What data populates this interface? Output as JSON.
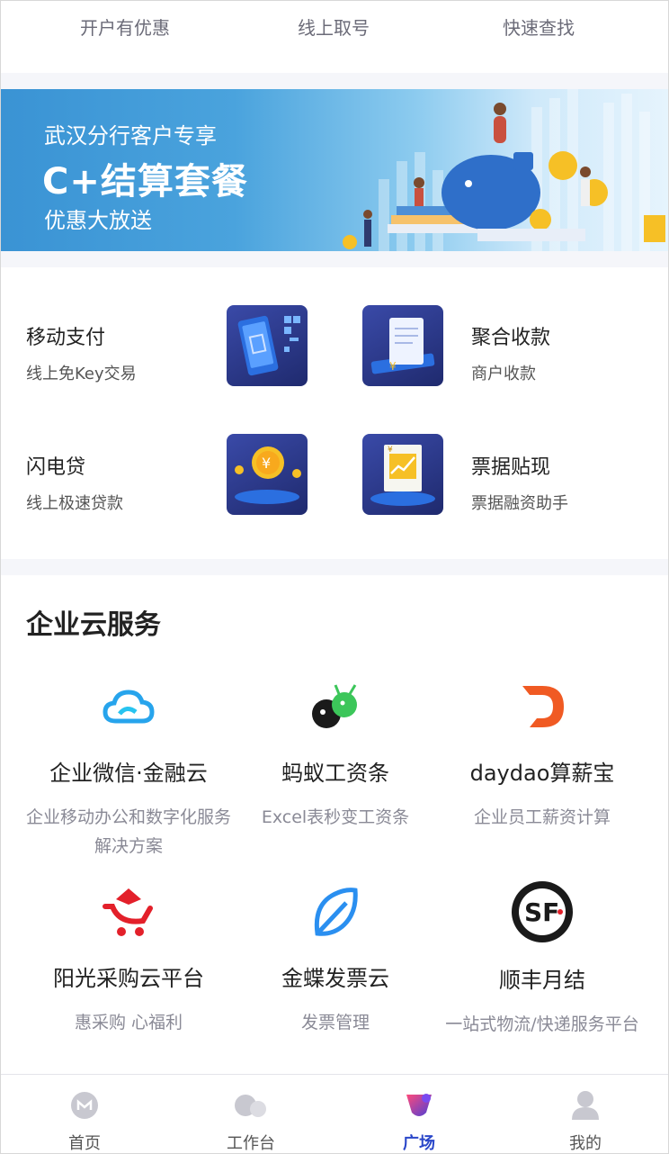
{
  "top_links": [
    "开户有优惠",
    "线上取号",
    "快速查找"
  ],
  "banner": {
    "line1": "武汉分行客户专享",
    "headline": "C+结算套餐",
    "line2": "优惠大放送"
  },
  "products": [
    {
      "title": "移动支付",
      "subtitle": "线上免Key交易",
      "icon": "phone-qr-icon"
    },
    {
      "title": "聚合收款",
      "subtitle": "商户收款",
      "icon": "receipt-icon"
    },
    {
      "title": "闪电贷",
      "subtitle": "线上极速贷款",
      "icon": "yuan-coin-icon"
    },
    {
      "title": "票据贴现",
      "subtitle": "票据融资助手",
      "icon": "bill-chart-icon"
    }
  ],
  "cloud_section": {
    "title": "企业云服务",
    "services": [
      {
        "name": "企业微信·金融云",
        "desc": "企业移动办公和数字化服务解决方案",
        "icon": "cloud-icon"
      },
      {
        "name": "蚂蚁工资条",
        "desc": "Excel表秒变工资条",
        "icon": "ant-icon"
      },
      {
        "name": "daydao算薪宝",
        "desc": "企业员工薪资计算",
        "icon": "daydao-logo-icon"
      },
      {
        "name": "阳光采购云平台",
        "desc": "惠采购 心福利",
        "icon": "shopping-cart-icon"
      },
      {
        "name": "金蝶发票云",
        "desc": "发票管理",
        "icon": "leaf-icon"
      },
      {
        "name": "顺丰月结",
        "desc": "一站式物流/快递服务平台",
        "icon": "sf-logo-icon"
      }
    ]
  },
  "tabbar": {
    "items": [
      {
        "label": "首页",
        "icon": "home-logo-icon"
      },
      {
        "label": "工作台",
        "icon": "workbench-icon"
      },
      {
        "label": "广场",
        "icon": "plaza-icon"
      },
      {
        "label": "我的",
        "icon": "user-icon"
      }
    ],
    "active": "广场"
  },
  "colors": {
    "accent": "#2a47c9",
    "banner_blue": "#3a93d4",
    "text_secondary": "#8a8a96"
  }
}
